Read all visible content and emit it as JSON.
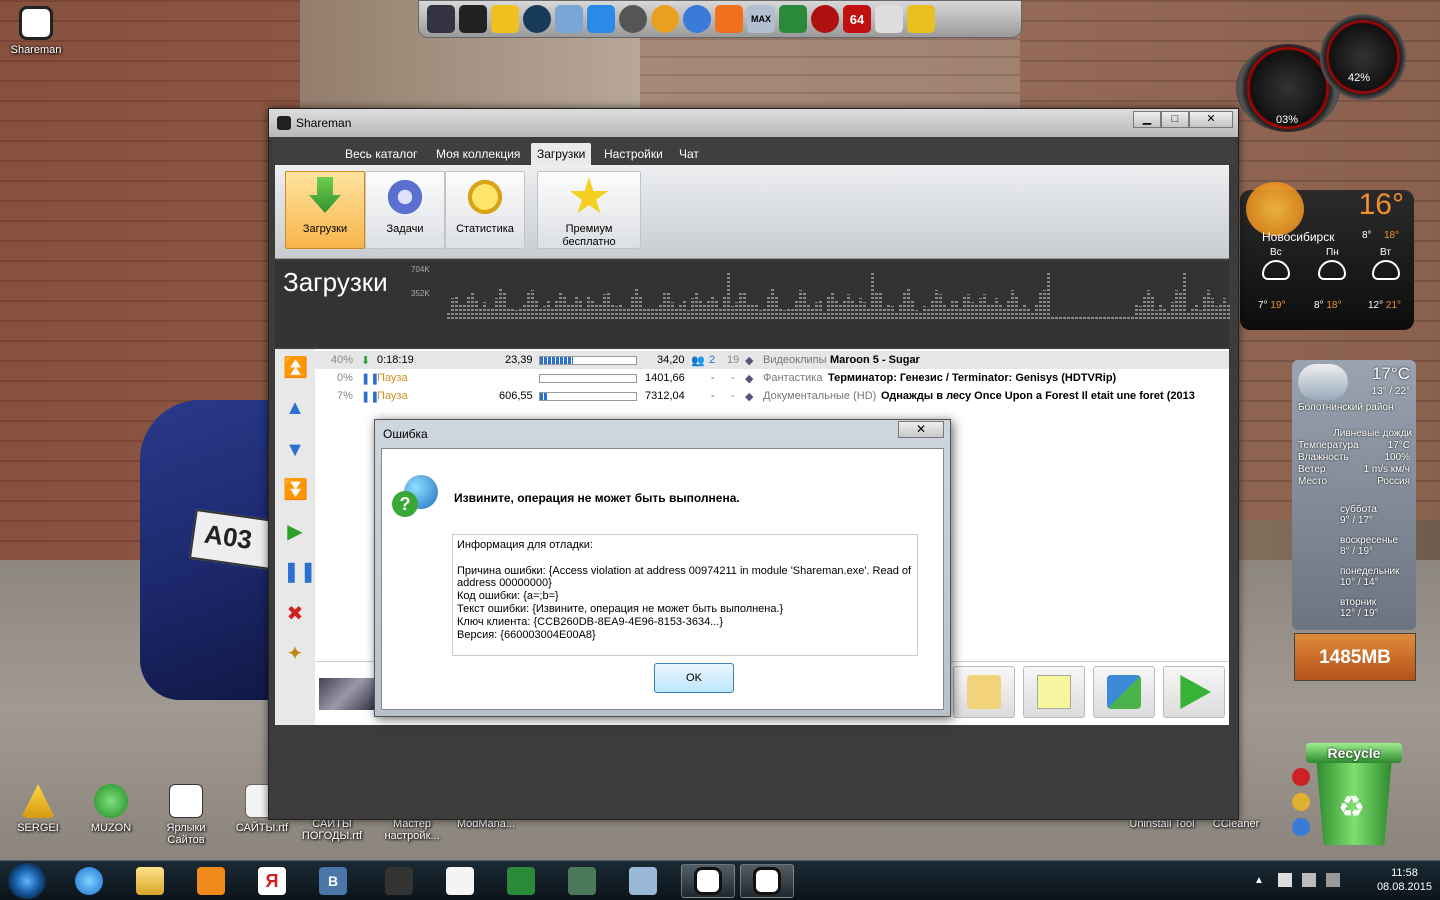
{
  "desktop": {
    "icons": [
      {
        "label": "Shareman"
      },
      {
        "label": "SERGEI"
      },
      {
        "label": "MUZON"
      },
      {
        "label": "Ярлыки Сайтов"
      },
      {
        "label": "САЙТЫ.rtf"
      },
      {
        "label": "САЙТЫ ПОГОДЫ.rtf"
      },
      {
        "label": "Мастер настройк..."
      },
      {
        "label": "ModMana..."
      },
      {
        "label": "Uninstall Tool"
      },
      {
        "label": "CCleaner"
      }
    ]
  },
  "launcher_icons": [
    "game-icon",
    "car-icon",
    "folder-icon",
    "steam-icon",
    "tool-icon",
    "arrow-icon",
    "sync-icon",
    "triangle-icon",
    "lightning-icon",
    "dragon-icon",
    "max-icon",
    "money-icon",
    "gear-icon",
    "aida-icon",
    "monitor-icon",
    "tools-icon"
  ],
  "launcher_text": {
    "max": "MAX",
    "aida": "64"
  },
  "gadgets": {
    "cpu_left": "03%",
    "cpu_right": "42%",
    "weather_main": {
      "temp": "16°",
      "city": "Новосибирск",
      "low": "8°",
      "high": "18°",
      "days": [
        {
          "name": "Вс",
          "low": "7°",
          "high": "19°"
        },
        {
          "name": "Пн",
          "low": "8°",
          "high": "18°"
        },
        {
          "name": "Вт",
          "low": "12°",
          "high": "21°"
        }
      ]
    },
    "weather_detail": {
      "temp": "17°C",
      "range": "13° / 22°",
      "district": "Болотнинский район",
      "condition": "Ливневые дожди",
      "rows": [
        {
          "k": "Температура",
          "v": "17°C"
        },
        {
          "k": "Влажность",
          "v": "100%"
        },
        {
          "k": "Ветер",
          "v": "1 m/s км/ч"
        },
        {
          "k": "Место",
          "v": "Россия"
        }
      ],
      "forecast": [
        {
          "day": "суббота",
          "temps": "9° / 17°"
        },
        {
          "day": "воскресенье",
          "temps": "8° / 19°"
        },
        {
          "day": "понедельник",
          "temps": "10° / 14°"
        },
        {
          "day": "вторник",
          "temps": "12° / 19°"
        }
      ]
    },
    "memory": "1485MB",
    "recycle": "Recycle"
  },
  "window": {
    "title": "Shareman",
    "controls": {
      "min": "▁",
      "max": "□",
      "close": "✕"
    },
    "tabs": [
      "Весь каталог",
      "Моя коллекция",
      "Загрузки",
      "Настройки",
      "Чат"
    ],
    "active_tab": "Загрузки",
    "ribbon": [
      {
        "label": "Загрузки",
        "active": true
      },
      {
        "label": "Задачи"
      },
      {
        "label": "Статистика"
      },
      {
        "label": "Премиум бесплатно"
      }
    ],
    "graph": {
      "title": "Загрузки",
      "label_high": "704K",
      "label_low": "352K"
    },
    "downloads": [
      {
        "pct": "40%",
        "status": "0:18:19",
        "downloaded": "23,39",
        "progress": 0.34,
        "size": "34,20",
        "peers": "2",
        "seeds": "19",
        "category": "Видеоклипы",
        "name": "Maroon 5 - Sugar",
        "selected": true
      },
      {
        "pct": "0%",
        "status": "Пауза",
        "downloaded": "",
        "progress": 0.0,
        "size": "1401,66",
        "peers": "-",
        "seeds": "-",
        "category": "Фантастика",
        "name": "Терминатор: Генезис / Terminator: Genisys (HDTVRip)"
      },
      {
        "pct": "7%",
        "status": "Пауза",
        "downloaded": "606,55",
        "progress": 0.07,
        "size": "7312,04",
        "peers": "-",
        "seeds": "-",
        "category": "Документальные (HD)",
        "name": "Однажды в лесу  Once Upon a Forest  Il etait une foret (2013"
      }
    ]
  },
  "dialog": {
    "title": "Ошибка",
    "close": "✕",
    "message": "Извините, операция не может быть выполнена.",
    "debug_header": "Информация для отладки:",
    "debug_lines": "Причина ошибки: {Access violation at address 00974211 in module 'Shareman.exe'. Read of address 00000000}\nКод ошибки: {a=;b=}\nТекст ошибки: {Извините, операция не может быть выполнена.}\nКлюч клиента: {CCB260DB-8EA9-4E96-8153-3634...}\nВерсия: {660003004E00A8}",
    "ok": "OK"
  },
  "taskbar": {
    "time": "11:58",
    "date": "08.08.2015"
  }
}
